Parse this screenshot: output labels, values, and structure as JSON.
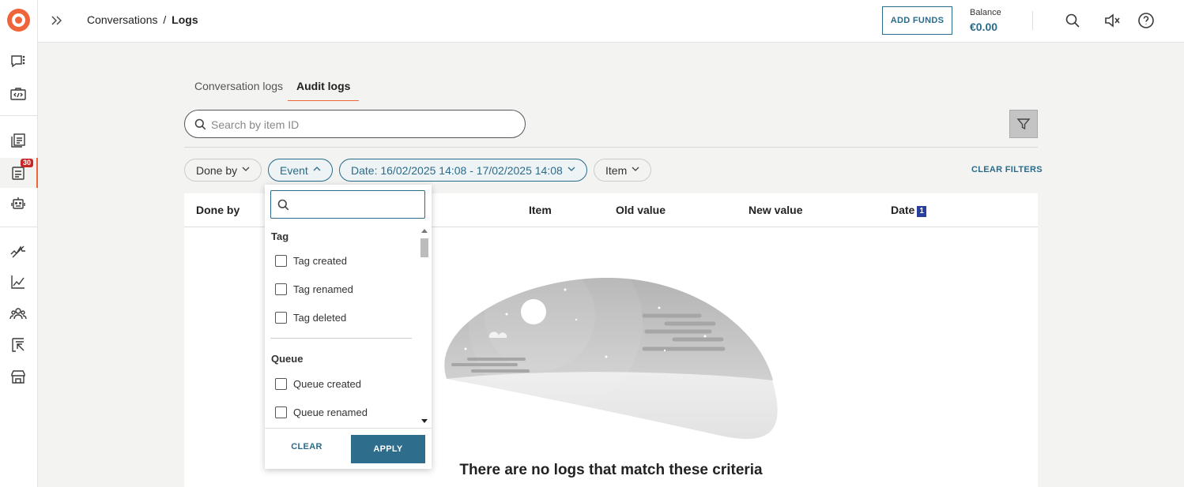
{
  "topbar": {
    "breadcrumb_parent": "Conversations",
    "breadcrumb_sep": "/",
    "breadcrumb_current": "Logs",
    "add_funds_label": "ADD FUNDS",
    "balance_label": "Balance",
    "balance_value": "€0.00"
  },
  "sidebar": {
    "badge_count": "30",
    "icons": [
      "conversations-icon",
      "developer-icon",
      "reports-icon",
      "logs-icon",
      "bot-icon",
      "activity-icon",
      "analytics-icon",
      "team-icon",
      "import-icon",
      "store-icon"
    ]
  },
  "tabs": [
    {
      "label": "Conversation logs",
      "active": false
    },
    {
      "label": "Audit logs",
      "active": true
    }
  ],
  "search": {
    "placeholder": "Search by item ID",
    "value": ""
  },
  "filters": {
    "done_by": "Done by",
    "event": "Event",
    "date": "Date: 16/02/2025 14:08 - 17/02/2025 14:08",
    "item": "Item",
    "clear_filters": "CLEAR FILTERS"
  },
  "table": {
    "columns": [
      "Done by",
      "Item",
      "Old value",
      "New value",
      "Date"
    ],
    "sort_badge": "1",
    "empty_message": "There are no logs that match these criteria"
  },
  "event_dropdown": {
    "search_value": "",
    "groups": [
      {
        "name": "Tag",
        "items": [
          "Tag created",
          "Tag renamed",
          "Tag deleted"
        ]
      },
      {
        "name": "Queue",
        "items": [
          "Queue created",
          "Queue renamed"
        ]
      }
    ],
    "clear_label": "CLEAR",
    "apply_label": "APPLY"
  },
  "colors": {
    "accent": "#f0643c",
    "primary": "#2a6b8a",
    "badge": "#c62828"
  }
}
